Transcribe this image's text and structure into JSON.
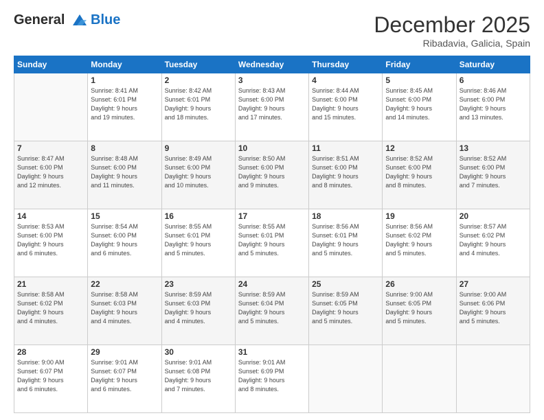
{
  "logo": {
    "line1": "General",
    "line2": "Blue"
  },
  "title": "December 2025",
  "subtitle": "Ribadavia, Galicia, Spain",
  "weekdays": [
    "Sunday",
    "Monday",
    "Tuesday",
    "Wednesday",
    "Thursday",
    "Friday",
    "Saturday"
  ],
  "weeks": [
    [
      {
        "day": null,
        "info": null
      },
      {
        "day": "1",
        "sunrise": "8:41 AM",
        "sunset": "6:01 PM",
        "daylight": "9 hours and 19 minutes."
      },
      {
        "day": "2",
        "sunrise": "8:42 AM",
        "sunset": "6:01 PM",
        "daylight": "9 hours and 18 minutes."
      },
      {
        "day": "3",
        "sunrise": "8:43 AM",
        "sunset": "6:00 PM",
        "daylight": "9 hours and 17 minutes."
      },
      {
        "day": "4",
        "sunrise": "8:44 AM",
        "sunset": "6:00 PM",
        "daylight": "9 hours and 15 minutes."
      },
      {
        "day": "5",
        "sunrise": "8:45 AM",
        "sunset": "6:00 PM",
        "daylight": "9 hours and 14 minutes."
      },
      {
        "day": "6",
        "sunrise": "8:46 AM",
        "sunset": "6:00 PM",
        "daylight": "9 hours and 13 minutes."
      }
    ],
    [
      {
        "day": "7",
        "sunrise": "8:47 AM",
        "sunset": "6:00 PM",
        "daylight": "9 hours and 12 minutes."
      },
      {
        "day": "8",
        "sunrise": "8:48 AM",
        "sunset": "6:00 PM",
        "daylight": "9 hours and 11 minutes."
      },
      {
        "day": "9",
        "sunrise": "8:49 AM",
        "sunset": "6:00 PM",
        "daylight": "9 hours and 10 minutes."
      },
      {
        "day": "10",
        "sunrise": "8:50 AM",
        "sunset": "6:00 PM",
        "daylight": "9 hours and 9 minutes."
      },
      {
        "day": "11",
        "sunrise": "8:51 AM",
        "sunset": "6:00 PM",
        "daylight": "9 hours and 8 minutes."
      },
      {
        "day": "12",
        "sunrise": "8:52 AM",
        "sunset": "6:00 PM",
        "daylight": "9 hours and 8 minutes."
      },
      {
        "day": "13",
        "sunrise": "8:52 AM",
        "sunset": "6:00 PM",
        "daylight": "9 hours and 7 minutes."
      }
    ],
    [
      {
        "day": "14",
        "sunrise": "8:53 AM",
        "sunset": "6:00 PM",
        "daylight": "9 hours and 6 minutes."
      },
      {
        "day": "15",
        "sunrise": "8:54 AM",
        "sunset": "6:00 PM",
        "daylight": "9 hours and 6 minutes."
      },
      {
        "day": "16",
        "sunrise": "8:55 AM",
        "sunset": "6:01 PM",
        "daylight": "9 hours and 5 minutes."
      },
      {
        "day": "17",
        "sunrise": "8:55 AM",
        "sunset": "6:01 PM",
        "daylight": "9 hours and 5 minutes."
      },
      {
        "day": "18",
        "sunrise": "8:56 AM",
        "sunset": "6:01 PM",
        "daylight": "9 hours and 5 minutes."
      },
      {
        "day": "19",
        "sunrise": "8:56 AM",
        "sunset": "6:02 PM",
        "daylight": "9 hours and 5 minutes."
      },
      {
        "day": "20",
        "sunrise": "8:57 AM",
        "sunset": "6:02 PM",
        "daylight": "9 hours and 4 minutes."
      }
    ],
    [
      {
        "day": "21",
        "sunrise": "8:58 AM",
        "sunset": "6:02 PM",
        "daylight": "9 hours and 4 minutes."
      },
      {
        "day": "22",
        "sunrise": "8:58 AM",
        "sunset": "6:03 PM",
        "daylight": "9 hours and 4 minutes."
      },
      {
        "day": "23",
        "sunrise": "8:59 AM",
        "sunset": "6:03 PM",
        "daylight": "9 hours and 4 minutes."
      },
      {
        "day": "24",
        "sunrise": "8:59 AM",
        "sunset": "6:04 PM",
        "daylight": "9 hours and 5 minutes."
      },
      {
        "day": "25",
        "sunrise": "8:59 AM",
        "sunset": "6:05 PM",
        "daylight": "9 hours and 5 minutes."
      },
      {
        "day": "26",
        "sunrise": "9:00 AM",
        "sunset": "6:05 PM",
        "daylight": "9 hours and 5 minutes."
      },
      {
        "day": "27",
        "sunrise": "9:00 AM",
        "sunset": "6:06 PM",
        "daylight": "9 hours and 5 minutes."
      }
    ],
    [
      {
        "day": "28",
        "sunrise": "9:00 AM",
        "sunset": "6:07 PM",
        "daylight": "9 hours and 6 minutes."
      },
      {
        "day": "29",
        "sunrise": "9:01 AM",
        "sunset": "6:07 PM",
        "daylight": "9 hours and 6 minutes."
      },
      {
        "day": "30",
        "sunrise": "9:01 AM",
        "sunset": "6:08 PM",
        "daylight": "9 hours and 7 minutes."
      },
      {
        "day": "31",
        "sunrise": "9:01 AM",
        "sunset": "6:09 PM",
        "daylight": "9 hours and 8 minutes."
      },
      {
        "day": null,
        "info": null
      },
      {
        "day": null,
        "info": null
      },
      {
        "day": null,
        "info": null
      }
    ]
  ],
  "labels": {
    "sunrise": "Sunrise:",
    "sunset": "Sunset:",
    "daylight": "Daylight:"
  }
}
